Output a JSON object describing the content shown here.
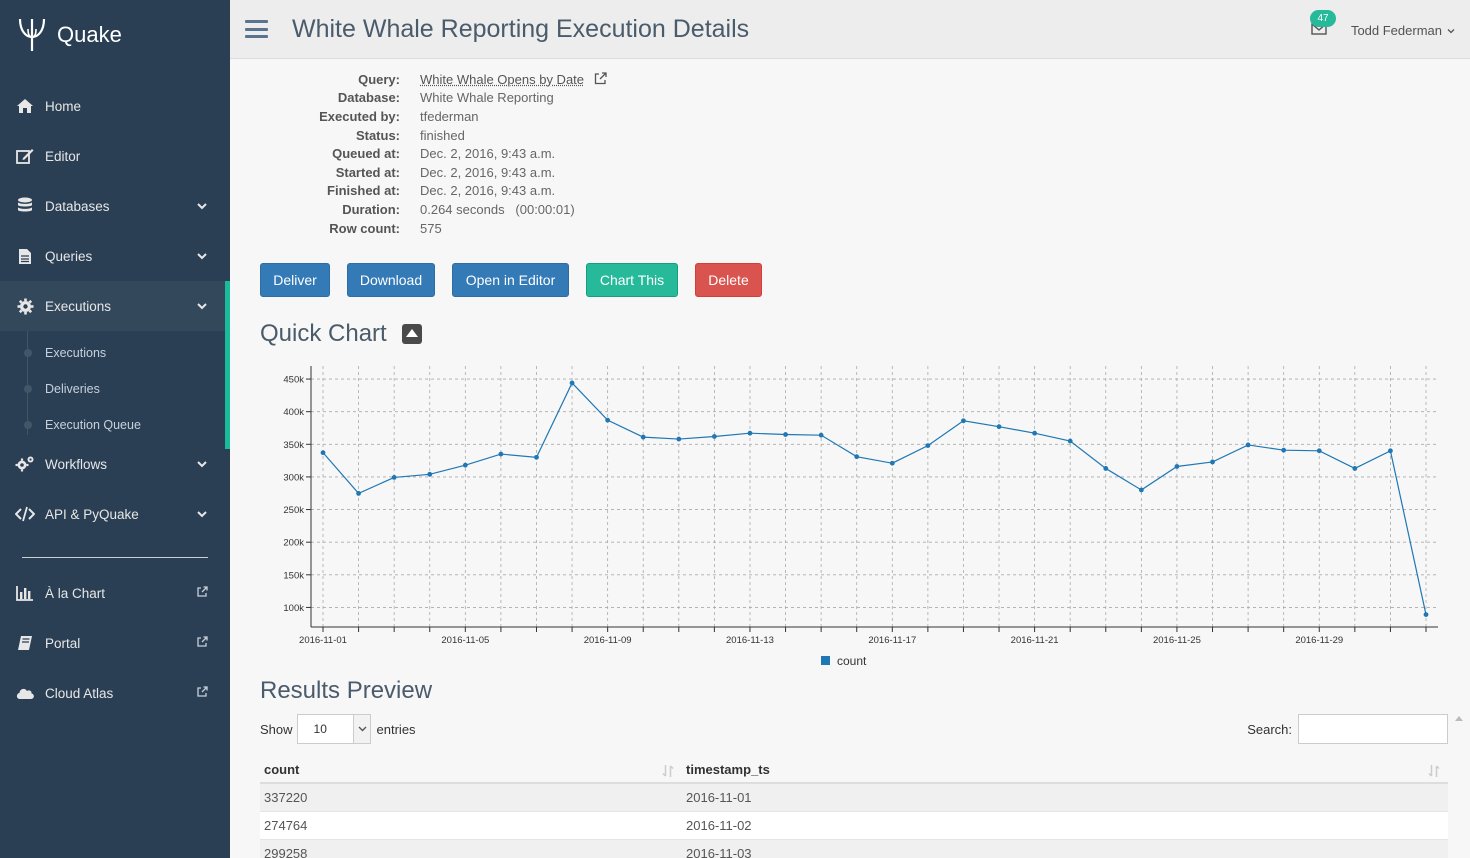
{
  "sidebar": {
    "brand": "Quake",
    "items": [
      {
        "label": "Home",
        "icon": "home-icon"
      },
      {
        "label": "Editor",
        "icon": "edit-icon"
      },
      {
        "label": "Databases",
        "icon": "database-icon"
      },
      {
        "label": "Queries",
        "icon": "file-icon"
      },
      {
        "label": "Executions",
        "icon": "gear-icon"
      },
      {
        "label": "Workflows",
        "icon": "gears-icon"
      },
      {
        "label": "API & PyQuake",
        "icon": "code-icon"
      }
    ],
    "subitems": [
      "Executions",
      "Deliveries",
      "Execution Queue"
    ],
    "external": [
      {
        "label": "À la Chart",
        "icon": "bar-chart-icon"
      },
      {
        "label": "Portal",
        "icon": "book-icon"
      },
      {
        "label": "Cloud Atlas",
        "icon": "cloud-icon"
      }
    ]
  },
  "header": {
    "title": "White Whale Reporting Execution Details",
    "mail_badge": "47",
    "user": "Todd Federman"
  },
  "details": [
    {
      "key": "Query:",
      "value": "White Whale Opens by Date"
    },
    {
      "key": "Database:",
      "value": "White Whale Reporting"
    },
    {
      "key": "Executed by:",
      "value": "tfederman"
    },
    {
      "key": "Status:",
      "value": "finished"
    },
    {
      "key": "Queued at:",
      "value": "Dec. 2, 2016, 9:43 a.m."
    },
    {
      "key": "Started at:",
      "value": "Dec. 2, 2016, 9:43 a.m."
    },
    {
      "key": "Finished at:",
      "value": "Dec. 2, 2016, 9:43 a.m."
    },
    {
      "key": "Duration:",
      "value": "0.264 seconds   (00:00:01)"
    },
    {
      "key": "Row count:",
      "value": "575"
    }
  ],
  "buttons": {
    "deliver": "Deliver",
    "download": "Download",
    "open_editor": "Open in Editor",
    "chart_this": "Chart This",
    "delete": "Delete"
  },
  "quick_chart_title": "Quick Chart",
  "chart_data": {
    "type": "line",
    "x": [
      "2016-11-01",
      "2016-11-02",
      "2016-11-03",
      "2016-11-04",
      "2016-11-05",
      "2016-11-06",
      "2016-11-07",
      "2016-11-08",
      "2016-11-09",
      "2016-11-10",
      "2016-11-11",
      "2016-11-12",
      "2016-11-13",
      "2016-11-14",
      "2016-11-15",
      "2016-11-16",
      "2016-11-17",
      "2016-11-18",
      "2016-11-19",
      "2016-11-20",
      "2016-11-21",
      "2016-11-22",
      "2016-11-23",
      "2016-11-24",
      "2016-11-25",
      "2016-11-26",
      "2016-11-27",
      "2016-11-28",
      "2016-11-29",
      "2016-11-30",
      "2016-12-01",
      "2016-12-02"
    ],
    "series": [
      {
        "name": "count",
        "color": "#1f77b4",
        "values": [
          337220,
          274764,
          299258,
          304000,
          318000,
          335000,
          330000,
          444000,
          387000,
          361000,
          358000,
          362000,
          367000,
          365000,
          364000,
          331000,
          321000,
          348000,
          386000,
          377000,
          367000,
          355000,
          313000,
          280000,
          316000,
          323000,
          349000,
          341000,
          340000,
          313000,
          340000,
          89000
        ]
      }
    ],
    "x_tick_labels": [
      "2016-11-01",
      "2016-11-05",
      "2016-11-09",
      "2016-11-13",
      "2016-11-17",
      "2016-11-21",
      "2016-11-25",
      "2016-11-29"
    ],
    "y_ticks": [
      100000,
      150000,
      200000,
      250000,
      300000,
      350000,
      400000,
      450000
    ],
    "y_tick_labels": [
      "100k",
      "150k",
      "200k",
      "250k",
      "300k",
      "350k",
      "400k",
      "450k"
    ],
    "ylim": [
      70000,
      470000
    ],
    "grid": true,
    "legend": "bottom-center"
  },
  "results": {
    "title": "Results Preview",
    "show_label": "Show",
    "entries_label": "entries",
    "page_size": "10",
    "search_label": "Search:",
    "search_value": "",
    "columns": [
      "count",
      "timestamp_ts"
    ],
    "rows": [
      [
        "337220",
        "2016-11-01"
      ],
      [
        "274764",
        "2016-11-02"
      ],
      [
        "299258",
        "2016-11-03"
      ]
    ]
  },
  "colors": {
    "sidebar": "#2a3f54",
    "accent": "#1abb9c",
    "primary": "#337ab7",
    "success": "#26b99a",
    "danger": "#d9534f"
  }
}
